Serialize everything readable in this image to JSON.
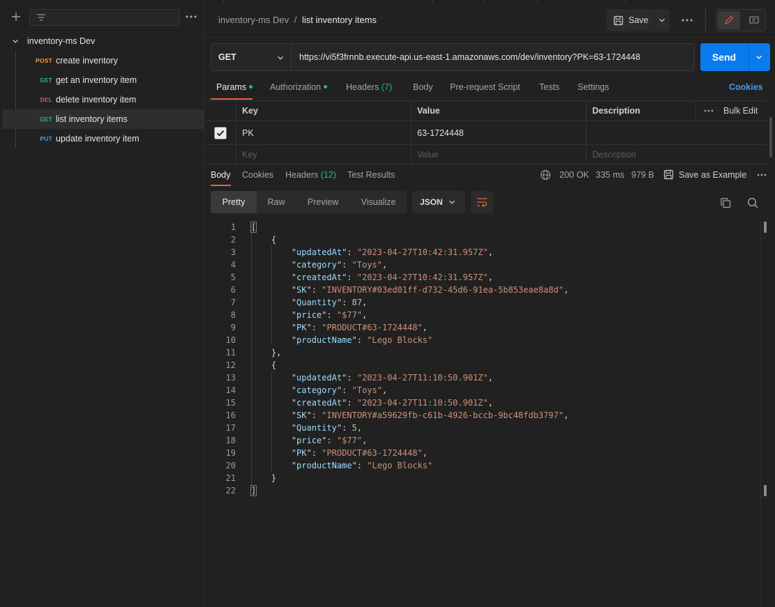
{
  "sidebar": {
    "collection_name": "inventory-ms Dev",
    "items": [
      {
        "method": "POST",
        "method_color": "#e8a33c",
        "label": "create inventory"
      },
      {
        "method": "GET",
        "method_color": "#2db87d",
        "label": "get an inventory item"
      },
      {
        "method": "DEL",
        "method_color": "#e5534b",
        "label": "delete inventory item"
      },
      {
        "method": "GET",
        "method_color": "#2db87d",
        "label": "list inventory items"
      },
      {
        "method": "PUT",
        "method_color": "#4e9bd6",
        "label": "update inventory item"
      }
    ],
    "active_index": 3
  },
  "header": {
    "breadcrumb_parent": "inventory-ms Dev",
    "breadcrumb_separator": "/",
    "breadcrumb_current": "list inventory items",
    "save_label": "Save"
  },
  "request": {
    "method": "GET",
    "url": "https://vi5f3frnnb.execute-api.us-east-1.amazonaws.com/dev/inventory?PK=63-1724448",
    "send_label": "Send"
  },
  "request_tabs": {
    "params": "Params",
    "authorization": "Authorization",
    "headers": "Headers",
    "headers_count": "(7)",
    "body": "Body",
    "pre_request_script": "Pre-request Script",
    "tests": "Tests",
    "settings": "Settings",
    "cookies": "Cookies"
  },
  "params_table": {
    "col_key": "Key",
    "col_value": "Value",
    "col_description": "Description",
    "bulk_edit": "Bulk Edit",
    "rows": [
      {
        "checked": true,
        "key": "PK",
        "value": "63-1724448",
        "description": ""
      }
    ],
    "placeholder_key": "Key",
    "placeholder_value": "Value",
    "placeholder_description": "Description"
  },
  "response_tabs": {
    "body": "Body",
    "cookies": "Cookies",
    "headers": "Headers",
    "headers_count": "(12)",
    "test_results": "Test Results"
  },
  "response_status": {
    "status": "200 OK",
    "time": "335 ms",
    "size": "979 B",
    "save_as_example": "Save as Example"
  },
  "view_modes": {
    "pretty": "Pretty",
    "raw": "Raw",
    "preview": "Preview",
    "visualize": "Visualize",
    "format": "JSON"
  },
  "code_lines": [
    {
      "n": "1",
      "text": "["
    },
    {
      "n": "2",
      "text": "    {"
    },
    {
      "n": "3",
      "key": "updatedAt",
      "val": "\"2023-04-27T10:42:31.957Z\"",
      "tail": ","
    },
    {
      "n": "4",
      "key": "category",
      "val": "\"Toys\"",
      "tail": ","
    },
    {
      "n": "5",
      "key": "createdAt",
      "val": "\"2023-04-27T10:42:31.957Z\"",
      "tail": ","
    },
    {
      "n": "6",
      "key": "SK",
      "val": "\"INVENTORY#03ed01ff-d732-45d6-91ea-5b853eae8a8d\"",
      "tail": ","
    },
    {
      "n": "7",
      "key": "Quantity",
      "num": "87",
      "tail": ","
    },
    {
      "n": "8",
      "key": "price",
      "val": "\"$77\"",
      "tail": ","
    },
    {
      "n": "9",
      "key": "PK",
      "val": "\"PRODUCT#63-1724448\"",
      "tail": ","
    },
    {
      "n": "10",
      "key": "productName",
      "val": "\"Lego Blocks\"",
      "tail": ""
    },
    {
      "n": "11",
      "text": "    },"
    },
    {
      "n": "12",
      "text": "    {"
    },
    {
      "n": "13",
      "key": "updatedAt",
      "val": "\"2023-04-27T11:10:50.901Z\"",
      "tail": ","
    },
    {
      "n": "14",
      "key": "category",
      "val": "\"Toys\"",
      "tail": ","
    },
    {
      "n": "15",
      "key": "createdAt",
      "val": "\"2023-04-27T11:10:50.901Z\"",
      "tail": ","
    },
    {
      "n": "16",
      "key": "SK",
      "val": "\"INVENTORY#a59629fb-c61b-4926-bccb-9bc48fdb3797\"",
      "tail": ","
    },
    {
      "n": "17",
      "key": "Quantity",
      "num": "5",
      "tail": ","
    },
    {
      "n": "18",
      "key": "price",
      "val": "\"$77\"",
      "tail": ","
    },
    {
      "n": "19",
      "key": "PK",
      "val": "\"PRODUCT#63-1724448\"",
      "tail": ","
    },
    {
      "n": "20",
      "key": "productName",
      "val": "\"Lego Blocks\"",
      "tail": ""
    },
    {
      "n": "21",
      "text": "    }"
    },
    {
      "n": "22",
      "text": "]"
    }
  ],
  "colors": {
    "accent_blue": "#097bed",
    "status_green": "#2db87d",
    "json_key": "#9cdcfe",
    "json_string": "#ce9178",
    "json_number": "#b5cea8"
  },
  "icons": {
    "new": "plus-icon",
    "filter": "filter-icon",
    "more": "more-horizontal-icon",
    "collapse": "chevron-down-icon",
    "save": "save-icon",
    "edit": "pencil-icon",
    "comments": "comment-icon",
    "globe": "globe-icon",
    "copy": "copy-icon",
    "search": "search-icon",
    "wrap": "wrap-lines-icon"
  }
}
